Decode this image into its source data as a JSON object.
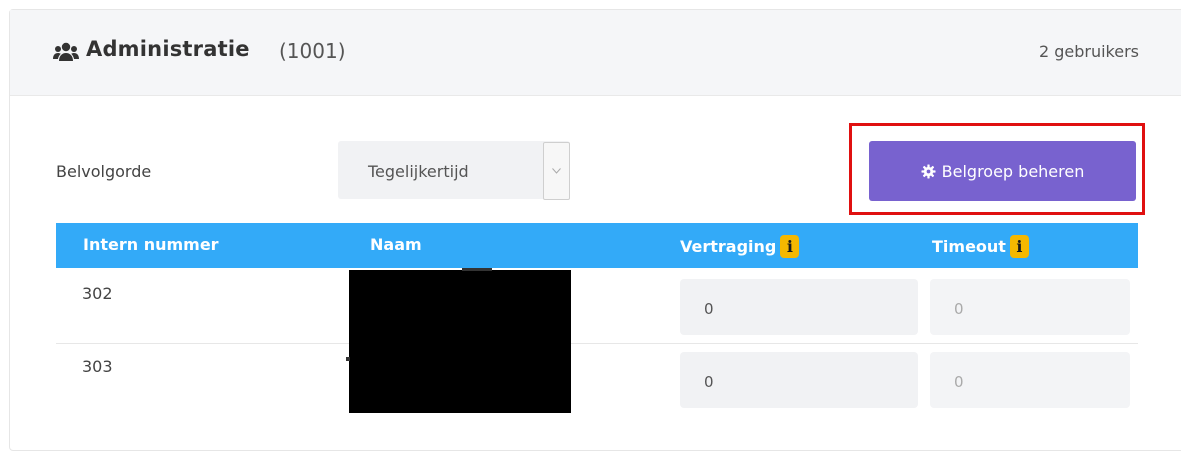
{
  "header": {
    "title": "Administratie",
    "count": "(1001)",
    "users": "2 gebruikers",
    "icon": "users-icon"
  },
  "ring_order": {
    "label": "Belvolgorde",
    "selected": "Tegelijkertijd"
  },
  "manage_button": {
    "label": "Belgroep beheren",
    "icon": "gear-icon"
  },
  "highlight_color": "#e01010",
  "table": {
    "columns": [
      "Intern nummer",
      "Naam",
      "Vertraging",
      "Timeout"
    ],
    "rows": [
      {
        "number": "302",
        "name": "",
        "delay": "0",
        "timeout": "0"
      },
      {
        "number": "303",
        "name": "",
        "delay": "0",
        "timeout": "0"
      }
    ]
  },
  "colors": {
    "accent": "#7862cf",
    "table_header": "#33aaf8",
    "info_badge": "#f5b800"
  }
}
